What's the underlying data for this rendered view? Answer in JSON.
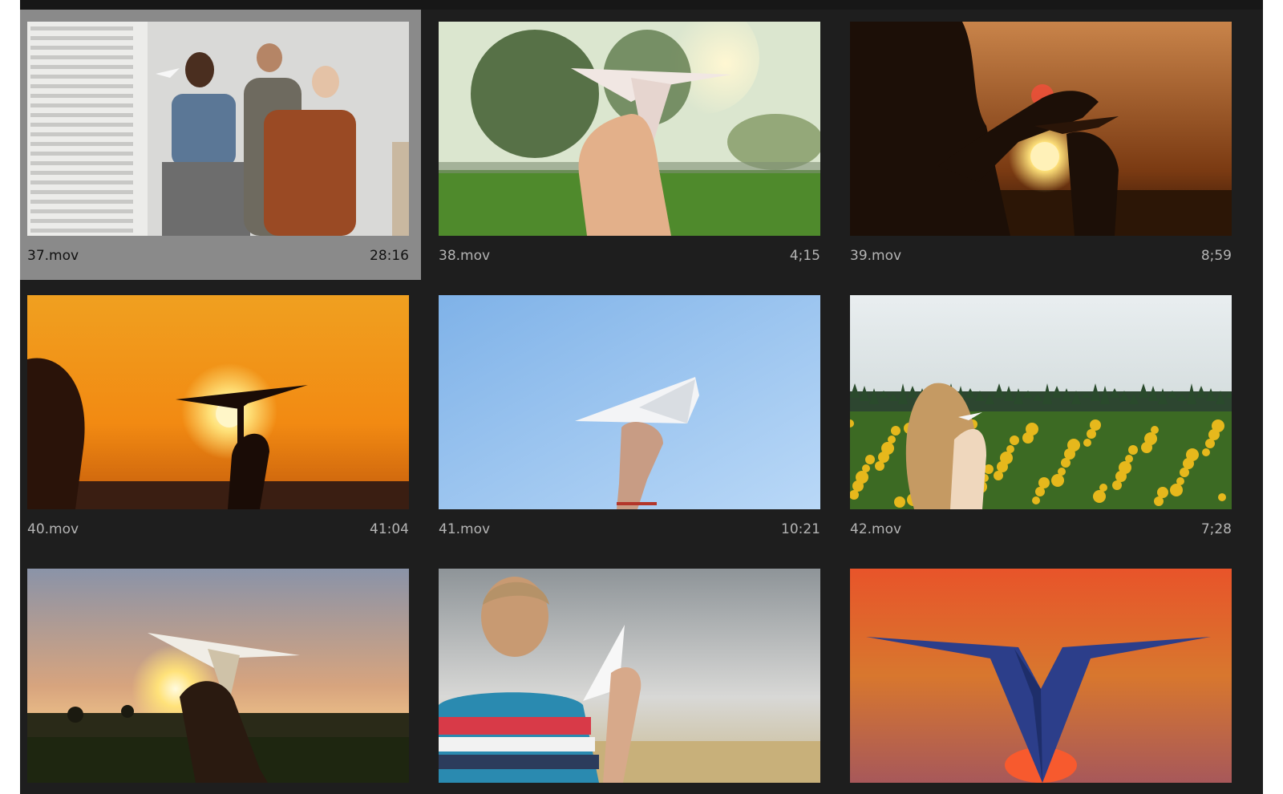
{
  "panel": {
    "background": "#1e1e1e",
    "selected_background": "#8a8a8a"
  },
  "clips": [
    {
      "name": "37.mov",
      "duration": "28:16",
      "selected": true,
      "thumbnail": "people-throwing-paper-planes-indoors"
    },
    {
      "name": "38.mov",
      "duration": "4;15",
      "selected": false,
      "thumbnail": "hand-holding-paper-plane-trees-sunset"
    },
    {
      "name": "39.mov",
      "duration": "8;59",
      "selected": false,
      "thumbnail": "silhouette-paper-plane-orange-sunset"
    },
    {
      "name": "40.mov",
      "duration": "41:04",
      "selected": false,
      "thumbnail": "paper-plane-silhouette-sun-orange-sky"
    },
    {
      "name": "41.mov",
      "duration": "10:21",
      "selected": false,
      "thumbnail": "white-paper-plane-blue-sky"
    },
    {
      "name": "42.mov",
      "duration": "7;28",
      "selected": false,
      "thumbnail": "girl-sunflower-field-paper-plane"
    },
    {
      "name": "",
      "duration": "",
      "selected": false,
      "thumbnail": "hand-paper-plane-field-sunset"
    },
    {
      "name": "",
      "duration": "",
      "selected": false,
      "thumbnail": "boy-striped-shirt-paper-plane"
    },
    {
      "name": "",
      "duration": "",
      "selected": false,
      "thumbnail": "blue-paper-plane-red-sunset"
    }
  ]
}
